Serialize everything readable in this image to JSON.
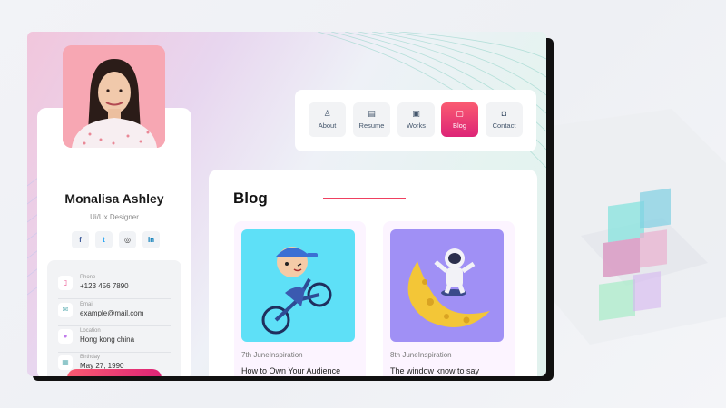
{
  "profile": {
    "name": "Monalisa Ashley",
    "role": "Ui/Ux Designer",
    "socials": [
      {
        "icon": "facebook-icon",
        "glyph": "f",
        "color": "#3b5998"
      },
      {
        "icon": "twitter-icon",
        "glyph": "t",
        "color": "#1da1f2"
      },
      {
        "icon": "dribbble-icon",
        "glyph": "◎",
        "color": "#444444"
      },
      {
        "icon": "linkedin-icon",
        "glyph": "in",
        "color": "#0077b5"
      }
    ],
    "contacts": [
      {
        "label": "Phone",
        "value": "+123 456 7890",
        "icon": "phone-icon",
        "glyph": "▯",
        "color": "#e93b81"
      },
      {
        "label": "Email",
        "value": "example@mail.com",
        "icon": "mail-icon",
        "glyph": "✉",
        "color": "#6ab5b9"
      },
      {
        "label": "Location",
        "value": "Hong kong china",
        "icon": "location-icon",
        "glyph": "●",
        "color": "#c17ceb"
      },
      {
        "label": "Birthday",
        "value": "May 27, 1990",
        "icon": "calendar-icon",
        "glyph": "▦",
        "color": "#6ab5b9"
      }
    ]
  },
  "nav": {
    "items": [
      {
        "label": "About",
        "icon": "user-icon",
        "glyph": "♙"
      },
      {
        "label": "Resume",
        "icon": "document-icon",
        "glyph": "▤"
      },
      {
        "label": "Works",
        "icon": "briefcase-icon",
        "glyph": "▣"
      },
      {
        "label": "Blog",
        "icon": "blog-icon",
        "glyph": "▢"
      },
      {
        "label": "Contact",
        "icon": "contact-icon",
        "glyph": "◘"
      }
    ],
    "active": "Blog"
  },
  "blog": {
    "title": "Blog",
    "posts": [
      {
        "meta": "7th JuneInspiration",
        "title": "How to Own Your Audience",
        "image_bg": "#5ee0f7",
        "image": "boy-on-bike-illustration"
      },
      {
        "meta": "8th JuneInspiration",
        "title": "The window know to say",
        "image_bg": "#a090f5",
        "image": "astronaut-on-moon-illustration"
      }
    ]
  },
  "colors": {
    "accent_start": "#fa5b71",
    "accent_end": "#dd2476"
  }
}
